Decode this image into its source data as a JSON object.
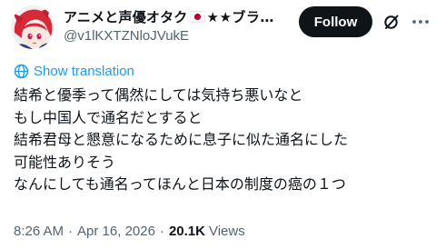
{
  "author": {
    "display_name": "アニメと声優オタク",
    "flag_icon": "japan-flag-icon",
    "name_suffix": "★★ブラ…",
    "handle": "@v1lKXTZNloJVukE"
  },
  "actions": {
    "follow_label": "Follow",
    "grok_icon": "grok-icon",
    "more_icon": "more-options-icon"
  },
  "translation": {
    "label": "Show translation",
    "icon": "globe-icon"
  },
  "body": {
    "lines": [
      "結希と優季って偶然にしては気持ち悪いなと",
      "もし中国人で通名だとすると",
      "結希君母と懇意になるために息子に似た通名にした",
      "可能性ありそう",
      "なんにしても通名ってほんと日本の制度の癌の１つ"
    ]
  },
  "meta": {
    "time": "8:26 AM",
    "separator": "·",
    "date": "Apr 16, 2026",
    "views_count": "20.1K",
    "views_label": "Views"
  },
  "colors": {
    "text": "#0f1419",
    "secondary": "#536471",
    "link": "#1d9bf0",
    "button_bg": "#0f1419"
  }
}
